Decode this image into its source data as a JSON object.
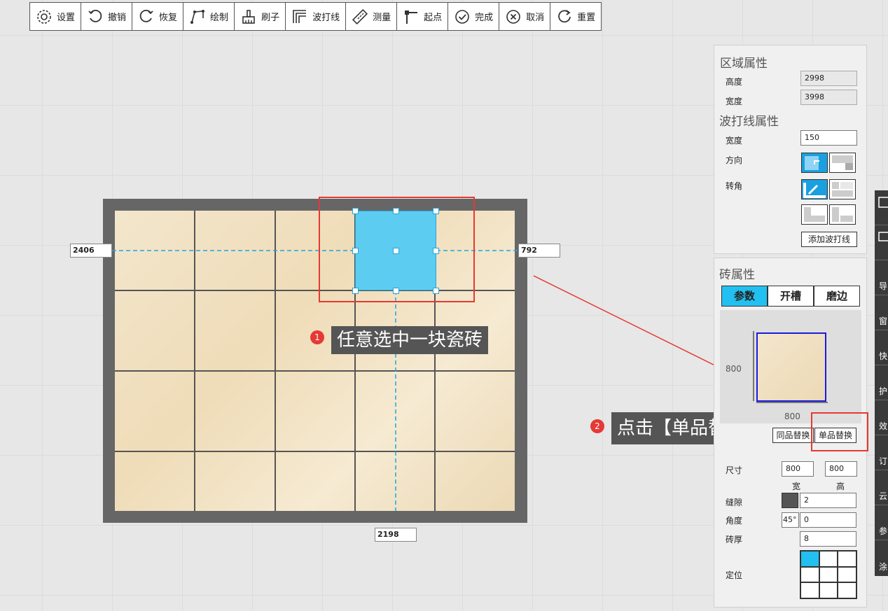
{
  "toolbar": {
    "items": [
      {
        "label": "设置",
        "icon": "gear-icon"
      },
      {
        "label": "撤销",
        "icon": "undo-icon"
      },
      {
        "label": "恢复",
        "icon": "redo-icon"
      },
      {
        "label": "绘制",
        "icon": "draw-icon"
      },
      {
        "label": "刷子",
        "icon": "brush-icon"
      },
      {
        "label": "波打线",
        "icon": "border-line-icon"
      },
      {
        "label": "测量",
        "icon": "ruler-icon"
      },
      {
        "label": "起点",
        "icon": "start-point-icon"
      },
      {
        "label": "完成",
        "icon": "check-circle-icon"
      },
      {
        "label": "取消",
        "icon": "x-circle-icon"
      },
      {
        "label": "重置",
        "icon": "reset-icon"
      }
    ]
  },
  "canvas": {
    "dim_left": "2406",
    "dim_right": "792",
    "dim_bottom": "2198"
  },
  "annotations": {
    "step1_num": "1",
    "step1_text": "任意选中一块瓷砖",
    "step2_num": "2",
    "step2_text": "点击【单品替换】"
  },
  "area_props": {
    "title": "区域属性",
    "height_label": "高度",
    "height_value": "2998",
    "width_label": "宽度",
    "width_value": "3998"
  },
  "border_props": {
    "title": "波打线属性",
    "width_label": "宽度",
    "width_value": "150",
    "direction_label": "方向",
    "corner_label": "转角",
    "add_button": "添加波打线"
  },
  "tile_props": {
    "title": "砖属性",
    "tabs": [
      "参数",
      "开槽",
      "磨边"
    ],
    "preview_height": "800",
    "preview_width": "800",
    "same_replace": "同品替换",
    "single_replace": "单品替换",
    "size_label": "尺寸",
    "size_w": "800",
    "size_h": "800",
    "w_label": "宽",
    "h_label": "高",
    "gap_label": "缝隙",
    "gap_value": "2",
    "gap_color": "#555555",
    "angle_label": "角度",
    "angle_badge": "45°",
    "angle_value": "0",
    "thickness_label": "砖厚",
    "thickness_value": "8",
    "position_label": "定位"
  },
  "side_strip": [
    "导",
    "窗",
    "快",
    "护",
    "效",
    "订",
    "云",
    "参",
    "涂"
  ],
  "colors": {
    "selected": "#5ccdf1",
    "accent": "#22c0f0",
    "annotation_red": "#e53935"
  }
}
